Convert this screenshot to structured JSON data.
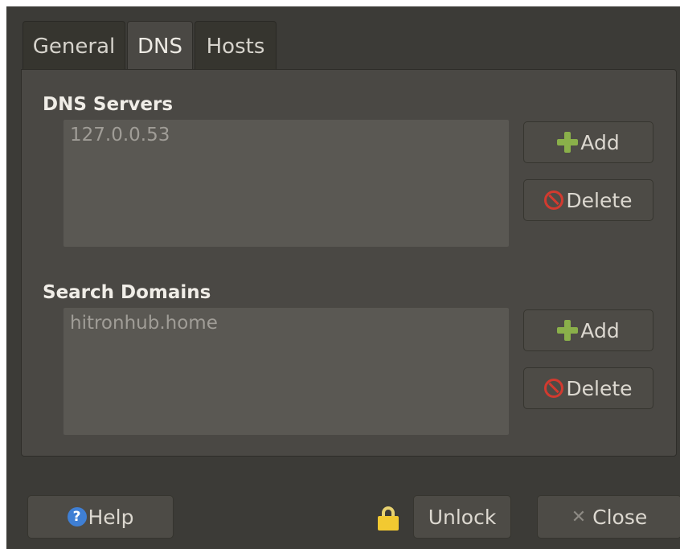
{
  "tabs": [
    {
      "label": "General"
    },
    {
      "label": "DNS"
    },
    {
      "label": "Hosts"
    }
  ],
  "active_tab": "DNS",
  "dns_servers": {
    "title": "DNS Servers",
    "entries": [
      "127.0.0.53"
    ],
    "add_label": "Add",
    "delete_label": "Delete"
  },
  "search_domains": {
    "title": "Search Domains",
    "entries": [
      "hitronhub.home"
    ],
    "add_label": "Add",
    "delete_label": "Delete"
  },
  "footer": {
    "help_label": "Help",
    "unlock_label": "Unlock",
    "close_label": "Close"
  },
  "icons": {
    "add": "plus-icon",
    "delete": "no-entry-icon",
    "help": "question-mark-icon",
    "lock": "padlock-icon",
    "close": "x-icon"
  },
  "colors": {
    "window_bg": "#3c3b37",
    "panel_bg": "#4a4844",
    "listbox_bg": "#5a5853",
    "add_green": "#8ab04a",
    "delete_red": "#d23a2f",
    "help_blue": "#3f7fd4",
    "lock_yellow": "#f2c931"
  }
}
